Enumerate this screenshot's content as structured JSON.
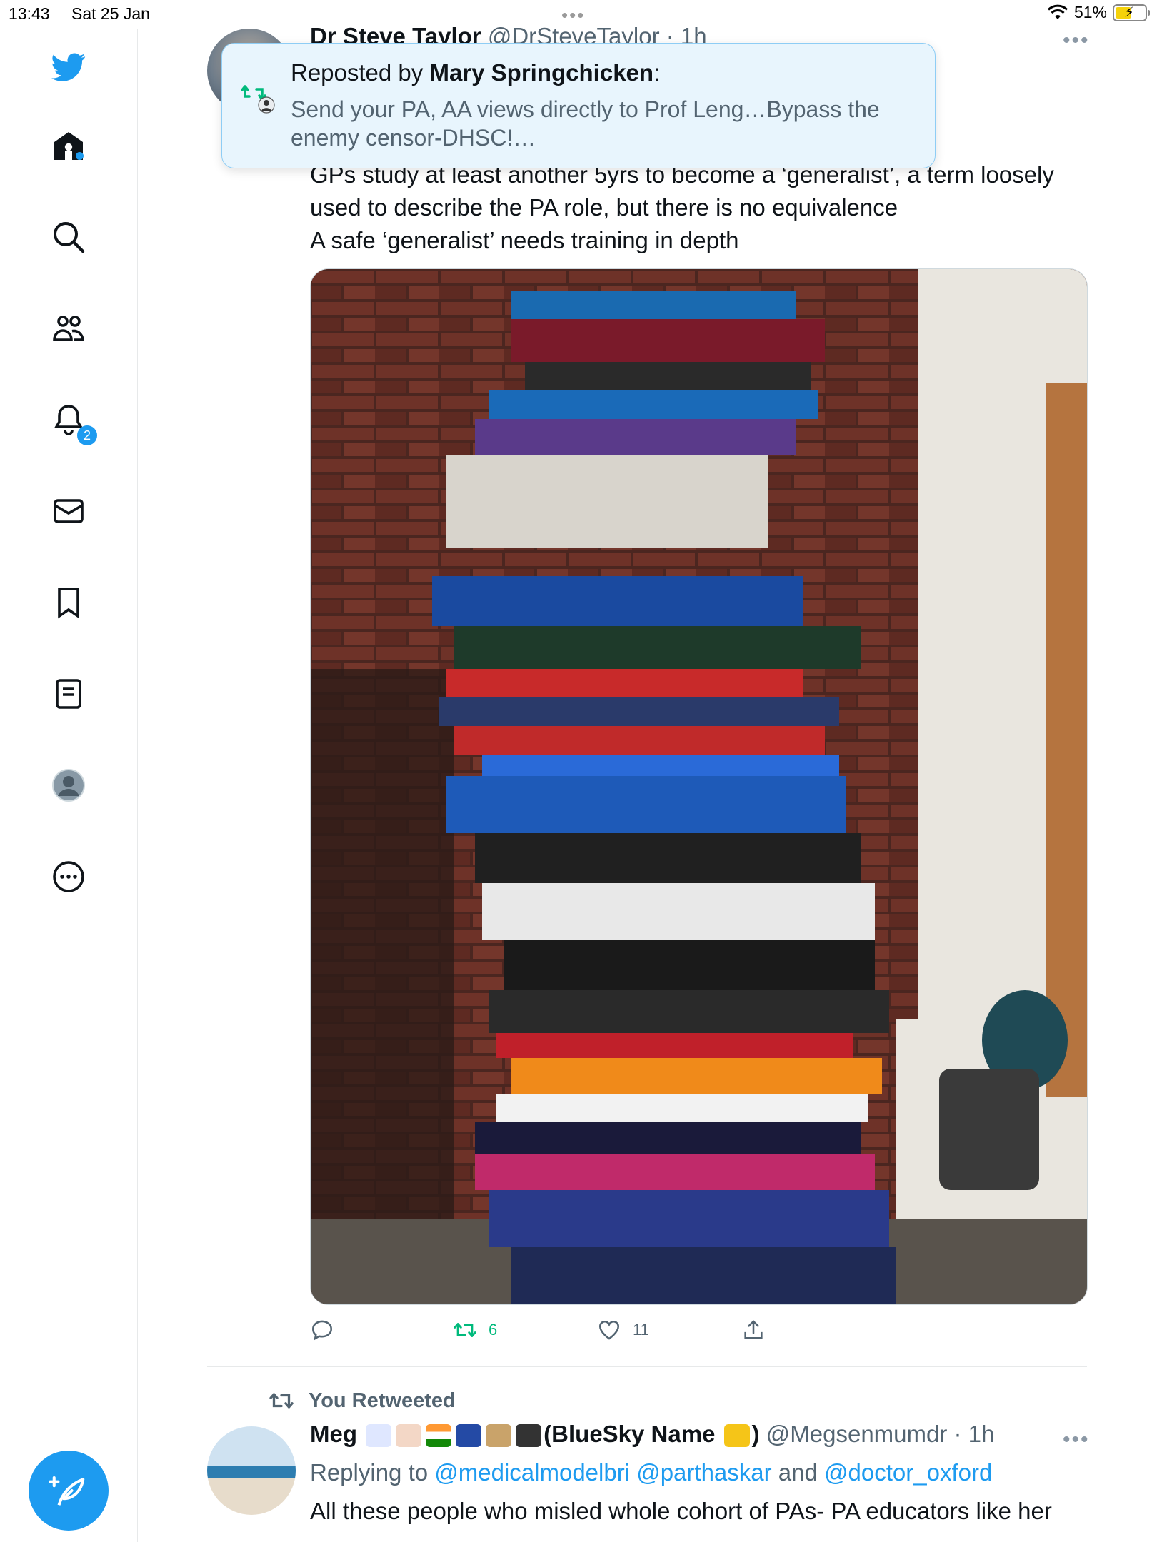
{
  "status_bar": {
    "time": "13:43",
    "date": "Sat 25 Jan",
    "battery": "51%"
  },
  "sidebar": {
    "notification_count": "2"
  },
  "tweet1": {
    "author_name": "Dr Steve Taylor",
    "author_handle": "@DrSteveTaylor · 1h",
    "text_lines": [
      "GPs study at least another 5yrs to become a ‘generalist’, a term loosely",
      "used to describe the PA role, but there is no equivalence",
      "A safe ‘generalist’ needs training in depth"
    ],
    "retweets": "6",
    "likes": "11"
  },
  "toast": {
    "prefix": "Reposted by ",
    "user": "Mary Springchicken",
    "suffix": ":",
    "message": "Send your PA, AA views directly to Prof Leng…Bypass the enemy censor-DHSC!…"
  },
  "tweet2": {
    "rt_label": "You Retweeted",
    "name_start": "Meg",
    "name_end": "(BlueSky Name",
    "name_close": ")",
    "handle": "@Megsenmumdr · 1h",
    "replying_prefix": "Replying to ",
    "reply_1": "@medicalmodelbri",
    "reply_2": "@parthaskar",
    "reply_and": " and ",
    "reply_3": "@doctor_oxford",
    "text": "All these people who misled whole cohort of PAs- PA educators like her"
  },
  "colors": {
    "accent": "#1d9bf0",
    "retweet_green": "#00ba7c",
    "secondary": "#536471"
  }
}
